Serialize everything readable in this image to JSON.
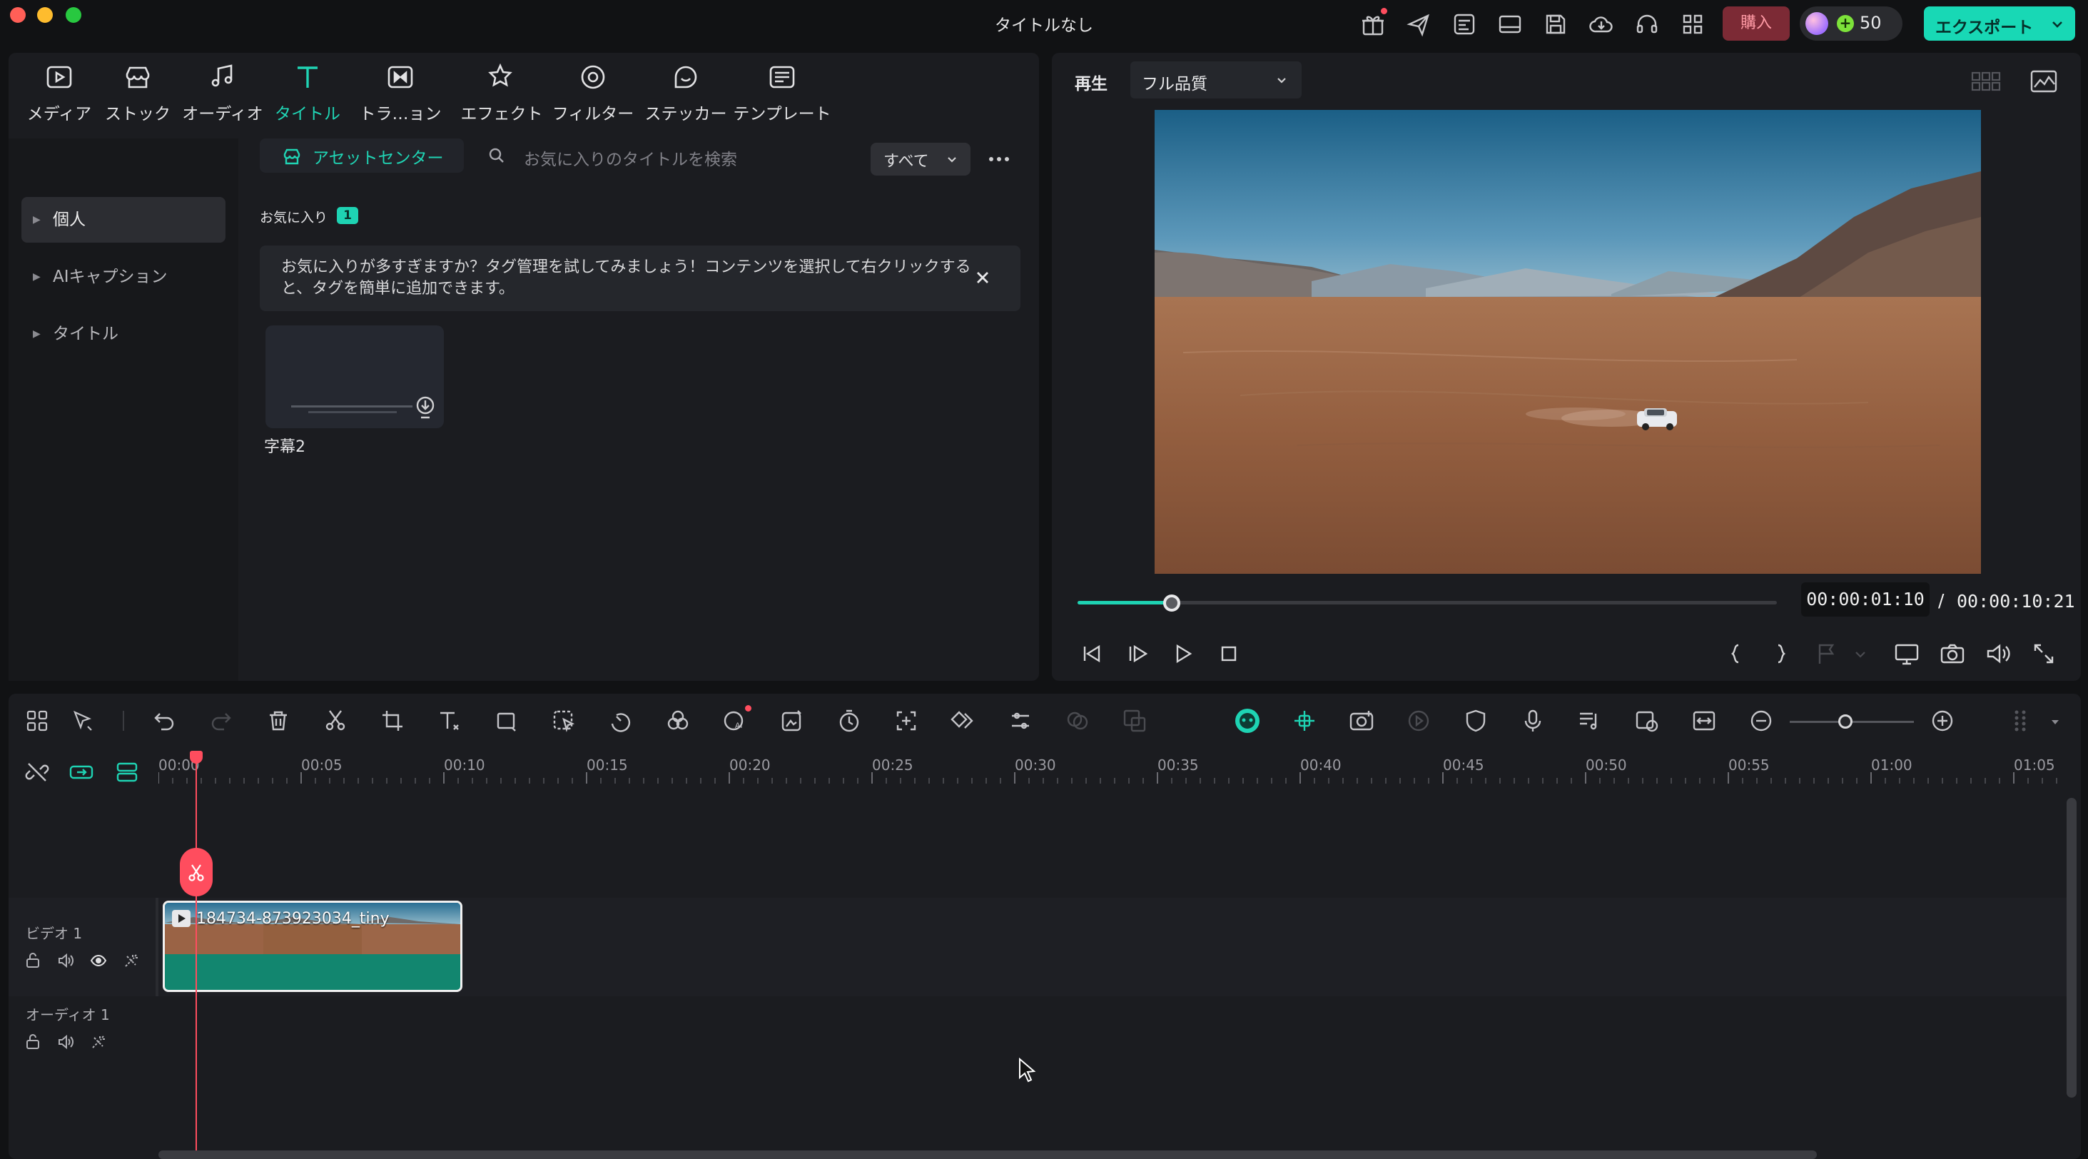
{
  "window": {
    "title": "タイトルなし"
  },
  "topbar": {
    "buy_label": "購入",
    "credits": "50",
    "export_label": "エクスポート",
    "icons": [
      "gift-icon",
      "send-icon",
      "template-icon",
      "layout-icon",
      "save-icon",
      "cloud-icon",
      "headset-icon",
      "grid-icon"
    ]
  },
  "tabs": [
    {
      "label": "メディア",
      "icon": "media-icon"
    },
    {
      "label": "ストック",
      "icon": "stock-icon"
    },
    {
      "label": "オーディオ",
      "icon": "music-icon"
    },
    {
      "label": "タイトル",
      "icon": "title-icon",
      "active": true
    },
    {
      "label": "トラ…ョン",
      "icon": "transition-icon"
    },
    {
      "label": "エフェクト",
      "icon": "effect-icon"
    },
    {
      "label": "フィルター",
      "icon": "filter-icon"
    },
    {
      "label": "ステッカー",
      "icon": "sticker-icon"
    },
    {
      "label": "テンプレート",
      "icon": "template-icon"
    }
  ],
  "sidebar": {
    "items": [
      {
        "label": "個人",
        "active": true
      },
      {
        "label": "AIキャプション"
      },
      {
        "label": "タイトル"
      }
    ]
  },
  "library": {
    "asset_center_label": "アセットセンター",
    "search_placeholder": "お気に入りのタイトルを検索",
    "filter_value": "すべて",
    "favorites_label": "お気に入り",
    "favorites_count": "1",
    "notice_text": "お気に入りが多すぎますか？タグ管理を試してみましょう！コンテンツを選択して右クリックすると、タグを簡単に追加できます。",
    "items": [
      {
        "name": "字幕2"
      }
    ]
  },
  "preview": {
    "label": "再生",
    "quality": "フル品質",
    "current_time": "00:00:01:10",
    "total_time": "00:00:10:21",
    "progress": 0.135
  },
  "timeline": {
    "ruler": [
      "00:00",
      "00:05",
      "00:10",
      "00:15",
      "00:20",
      "00:25",
      "00:30",
      "00:35",
      "00:40",
      "00:45",
      "00:50",
      "00:55",
      "01:00",
      "01:05"
    ],
    "tracks": [
      {
        "label": "ビデオ 1"
      },
      {
        "label": "オーディオ 1"
      }
    ],
    "clip_name": "184734-873923034_tiny",
    "zoom_level": 0.45
  },
  "colors": {
    "accent": "#1ed3b3",
    "playhead": "#ff4d5e",
    "buy": "#7c2a35"
  }
}
